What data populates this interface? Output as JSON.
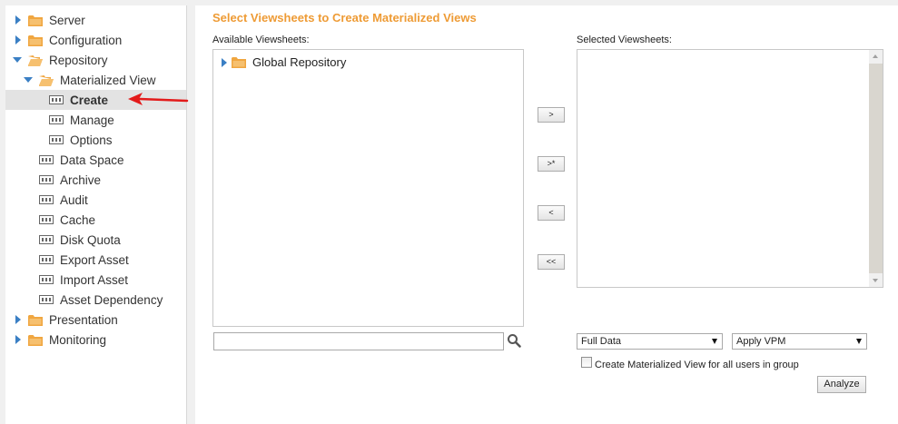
{
  "sidebar": {
    "items": [
      {
        "label": "Server"
      },
      {
        "label": "Configuration"
      },
      {
        "label": "Repository"
      },
      {
        "label": "Materialized View"
      },
      {
        "label": "Create"
      },
      {
        "label": "Manage"
      },
      {
        "label": "Options"
      },
      {
        "label": "Data Space"
      },
      {
        "label": "Archive"
      },
      {
        "label": "Audit"
      },
      {
        "label": "Cache"
      },
      {
        "label": "Disk Quota"
      },
      {
        "label": "Export Asset"
      },
      {
        "label": "Import Asset"
      },
      {
        "label": "Asset Dependency"
      },
      {
        "label": "Presentation"
      },
      {
        "label": "Monitoring"
      }
    ]
  },
  "main": {
    "title": "Select Viewsheets to Create Materialized Views",
    "available_label": "Available Viewsheets:",
    "selected_label": "Selected Viewsheets:",
    "available_items": [
      {
        "label": "Global Repository"
      }
    ],
    "move_buttons": {
      "add": ">",
      "add_all": ">*",
      "remove": "<",
      "remove_all": "<<"
    },
    "search": {
      "value": ""
    },
    "data_select": {
      "value": "Full Data"
    },
    "vpm_select": {
      "value": "Apply VPM"
    },
    "checkbox_label": "Create Materialized View for all users in group",
    "analyze_label": "Analyze"
  },
  "colors": {
    "accent": "#ee9b35",
    "folder": "#f0a640",
    "toggle": "#3a7fc4",
    "annotation": "#e31b1b"
  }
}
